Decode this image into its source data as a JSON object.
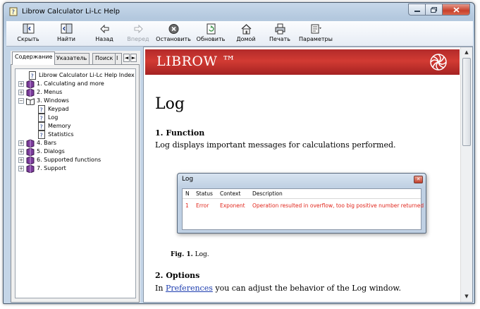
{
  "window": {
    "title": "Librow Calculator Li-Lc Help"
  },
  "toolbar": {
    "hide": "Скрыть",
    "find": "Найти",
    "back": "Назад",
    "forward": "Вперед",
    "stop": "Остановить",
    "refresh": "Обновить",
    "home": "Домой",
    "print": "Печать",
    "options": "Параметры"
  },
  "nav": {
    "tabs": [
      "Содержание",
      "Указатель",
      "Поиск",
      "І"
    ],
    "tree": [
      {
        "label": "Librow Calculator Li-Lc Help Index"
      },
      {
        "label": "1. Calculating and more"
      },
      {
        "label": "2. Menus"
      },
      {
        "label": "3. Windows"
      },
      {
        "label": "Keypad"
      },
      {
        "label": "Log"
      },
      {
        "label": "Memory"
      },
      {
        "label": "Statistics"
      },
      {
        "label": "4. Bars"
      },
      {
        "label": "5. Dialogs"
      },
      {
        "label": "6. Supported functions"
      },
      {
        "label": "7. Support"
      }
    ]
  },
  "content": {
    "brand": "LIBROW ™",
    "heading": "Log",
    "section1": "1. Function",
    "para1": "Log displays important messages for calculations performed.",
    "figure": {
      "window_title": "Log",
      "columns": [
        "N",
        "Status",
        "Context",
        "Description"
      ],
      "row": [
        "1",
        "Error",
        "Exponent",
        "Operation resulted in overflow, too big positive number returned"
      ],
      "caption_label": "Fig. 1.",
      "caption_text": "Log."
    },
    "section2": "2. Options",
    "para2_before": "In ",
    "para2_link": "Preferences",
    "para2_after": " you can adjust the behavior of the Log window."
  },
  "colors": {
    "banner": "#c0302b",
    "error": "#e1261c",
    "link": "#1f3fb0"
  }
}
